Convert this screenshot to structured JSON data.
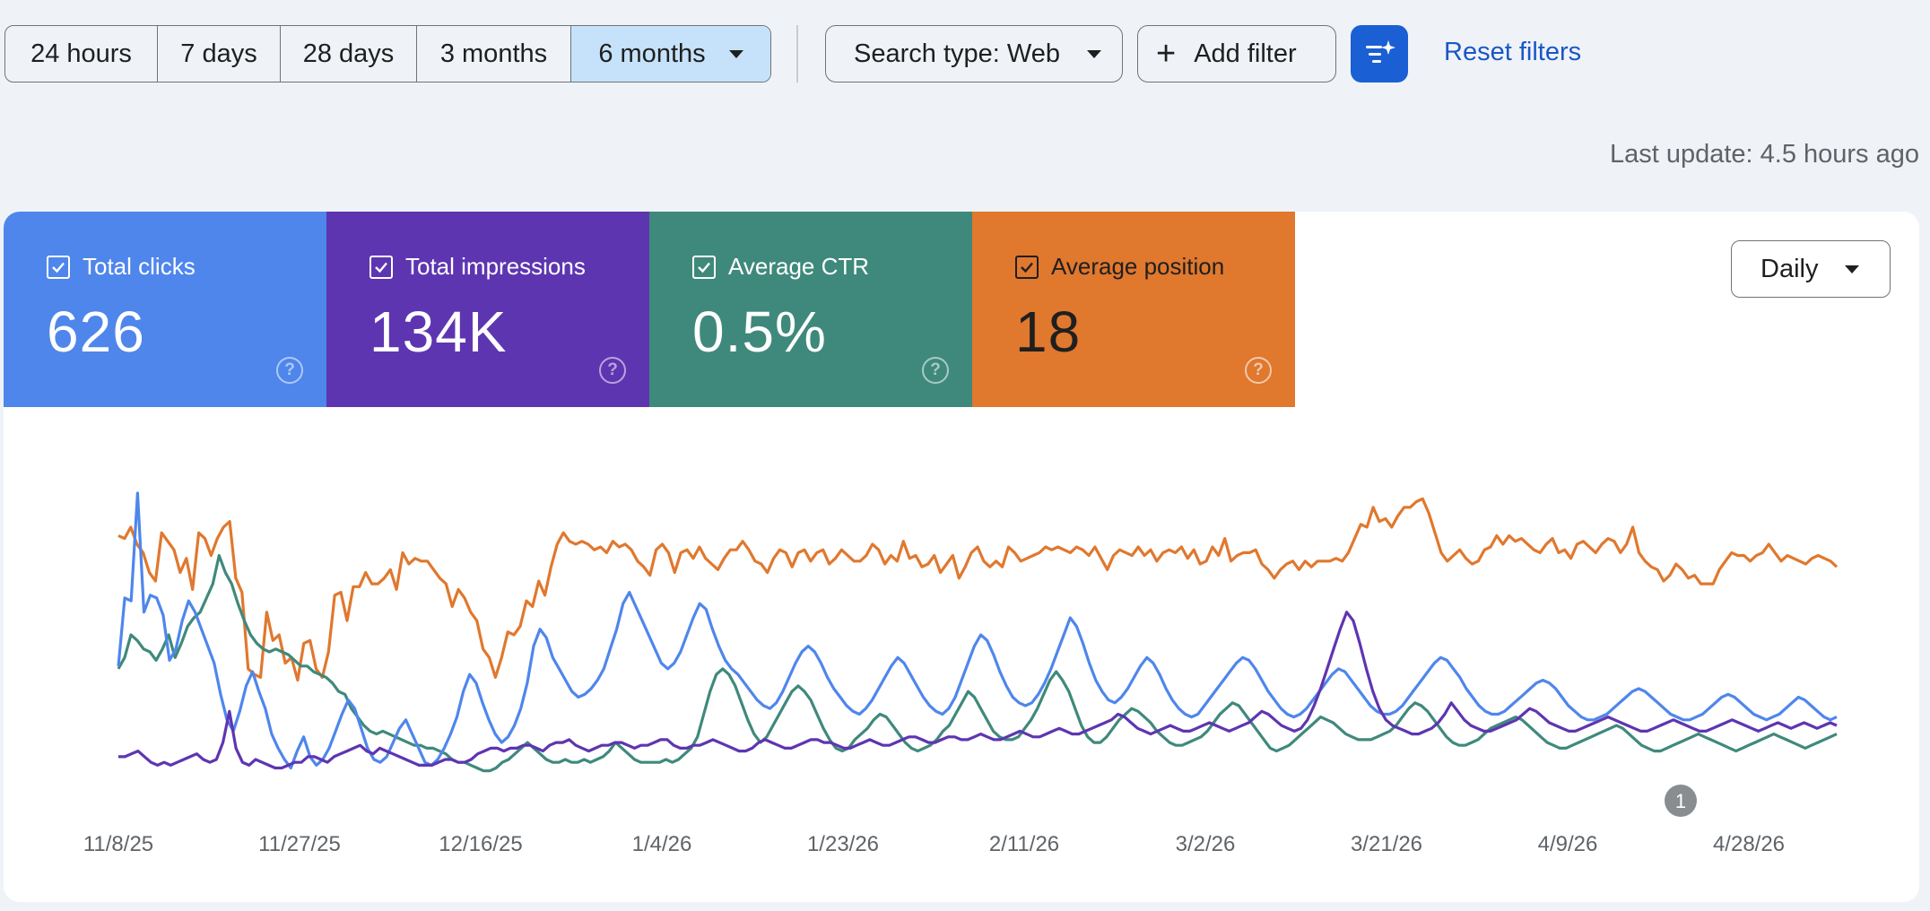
{
  "filters": {
    "ranges": [
      {
        "label": "24 hours",
        "width": 170
      },
      {
        "label": "7 days",
        "width": 137
      },
      {
        "label": "28 days",
        "width": 152
      },
      {
        "label": "3 months",
        "width": 172
      },
      {
        "label": "6 months",
        "width": 222,
        "selected": true
      }
    ],
    "search_type": "Search type: Web",
    "add_filter": "Add filter",
    "reset": "Reset filters"
  },
  "last_update": "Last update: 4.5 hours ago",
  "metrics": {
    "clicks": {
      "label": "Total clicks",
      "value": "626",
      "color": "#4f86ec"
    },
    "impressions": {
      "label": "Total impressions",
      "value": "134K",
      "color": "#5e35b1"
    },
    "ctr": {
      "label": "Average CTR",
      "value": "0.5%",
      "color": "#3f897c"
    },
    "position": {
      "label": "Average position",
      "value": "18",
      "color": "#e0782e"
    }
  },
  "granularity": "Daily",
  "chart_data": {
    "type": "line",
    "x_ticks": [
      "11/8/25",
      "11/27/25",
      "12/16/25",
      "1/4/26",
      "1/23/26",
      "2/11/26",
      "3/2/26",
      "3/21/26",
      "4/9/26",
      "4/28/26"
    ],
    "annotation": "1",
    "normalized": true,
    "series": [
      {
        "name": "Average position",
        "color": "#e0782e",
        "values": [
          0.85,
          0.84,
          0.88,
          0.82,
          0.79,
          0.72,
          0.69,
          0.86,
          0.83,
          0.8,
          0.72,
          0.77,
          0.66,
          0.86,
          0.84,
          0.78,
          0.84,
          0.88,
          0.9,
          0.7,
          0.65,
          0.38,
          0.36,
          0.35,
          0.58,
          0.48,
          0.5,
          0.4,
          0.42,
          0.34,
          0.47,
          0.48,
          0.38,
          0.35,
          0.44,
          0.64,
          0.65,
          0.55,
          0.67,
          0.67,
          0.72,
          0.68,
          0.68,
          0.7,
          0.73,
          0.66,
          0.79,
          0.75,
          0.77,
          0.76,
          0.76,
          0.73,
          0.7,
          0.68,
          0.6,
          0.66,
          0.63,
          0.58,
          0.55,
          0.45,
          0.42,
          0.35,
          0.42,
          0.51,
          0.5,
          0.53,
          0.62,
          0.6,
          0.69,
          0.64,
          0.74,
          0.82,
          0.86,
          0.83,
          0.82,
          0.83,
          0.82,
          0.8,
          0.81,
          0.79,
          0.83,
          0.81,
          0.82,
          0.8,
          0.76,
          0.74,
          0.71,
          0.8,
          0.82,
          0.79,
          0.72,
          0.79,
          0.8,
          0.77,
          0.81,
          0.77,
          0.75,
          0.73,
          0.77,
          0.8,
          0.8,
          0.83,
          0.8,
          0.76,
          0.75,
          0.72,
          0.77,
          0.8,
          0.79,
          0.74,
          0.79,
          0.8,
          0.76,
          0.79,
          0.8,
          0.75,
          0.77,
          0.8,
          0.78,
          0.76,
          0.76,
          0.78,
          0.82,
          0.8,
          0.75,
          0.78,
          0.76,
          0.83,
          0.77,
          0.78,
          0.74,
          0.75,
          0.78,
          0.72,
          0.75,
          0.78,
          0.7,
          0.74,
          0.79,
          0.81,
          0.76,
          0.74,
          0.76,
          0.74,
          0.81,
          0.79,
          0.76,
          0.77,
          0.78,
          0.79,
          0.81,
          0.8,
          0.81,
          0.8,
          0.79,
          0.81,
          0.8,
          0.78,
          0.81,
          0.77,
          0.73,
          0.78,
          0.8,
          0.79,
          0.78,
          0.81,
          0.78,
          0.8,
          0.76,
          0.79,
          0.8,
          0.79,
          0.81,
          0.77,
          0.8,
          0.75,
          0.76,
          0.81,
          0.78,
          0.84,
          0.76,
          0.78,
          0.79,
          0.79,
          0.8,
          0.75,
          0.73,
          0.7,
          0.73,
          0.75,
          0.76,
          0.73,
          0.76,
          0.74,
          0.76,
          0.76,
          0.76,
          0.77,
          0.76,
          0.79,
          0.84,
          0.89,
          0.88,
          0.95,
          0.9,
          0.91,
          0.88,
          0.92,
          0.95,
          0.95,
          0.97,
          0.98,
          0.93,
          0.86,
          0.79,
          0.76,
          0.78,
          0.8,
          0.77,
          0.75,
          0.76,
          0.8,
          0.81,
          0.85,
          0.82,
          0.85,
          0.83,
          0.84,
          0.82,
          0.8,
          0.79,
          0.82,
          0.84,
          0.79,
          0.8,
          0.77,
          0.82,
          0.83,
          0.81,
          0.79,
          0.82,
          0.84,
          0.83,
          0.79,
          0.82,
          0.88,
          0.79,
          0.76,
          0.74,
          0.73,
          0.69,
          0.71,
          0.75,
          0.73,
          0.7,
          0.71,
          0.68,
          0.68,
          0.68,
          0.73,
          0.76,
          0.79,
          0.78,
          0.78,
          0.76,
          0.78,
          0.79,
          0.82,
          0.79,
          0.76,
          0.78,
          0.77,
          0.76,
          0.75,
          0.77,
          0.78,
          0.77,
          0.76,
          0.74
        ]
      },
      {
        "name": "Average CTR",
        "color": "#3f897c",
        "values": [
          0.38,
          0.42,
          0.5,
          0.48,
          0.45,
          0.44,
          0.41,
          0.45,
          0.5,
          0.42,
          0.47,
          0.53,
          0.56,
          0.58,
          0.63,
          0.68,
          0.78,
          0.72,
          0.68,
          0.61,
          0.55,
          0.5,
          0.47,
          0.45,
          0.44,
          0.45,
          0.44,
          0.43,
          0.41,
          0.39,
          0.39,
          0.37,
          0.36,
          0.35,
          0.33,
          0.3,
          0.29,
          0.24,
          0.21,
          0.18,
          0.16,
          0.15,
          0.16,
          0.15,
          0.14,
          0.13,
          0.12,
          0.11,
          0.11,
          0.1,
          0.1,
          0.09,
          0.08,
          0.06,
          0.05,
          0.05,
          0.04,
          0.03,
          0.02,
          0.02,
          0.03,
          0.05,
          0.06,
          0.08,
          0.1,
          0.12,
          0.1,
          0.08,
          0.06,
          0.05,
          0.05,
          0.06,
          0.05,
          0.05,
          0.06,
          0.05,
          0.06,
          0.07,
          0.09,
          0.12,
          0.1,
          0.08,
          0.06,
          0.05,
          0.05,
          0.05,
          0.05,
          0.06,
          0.05,
          0.06,
          0.08,
          0.1,
          0.14,
          0.22,
          0.3,
          0.36,
          0.38,
          0.36,
          0.32,
          0.26,
          0.2,
          0.15,
          0.12,
          0.14,
          0.18,
          0.22,
          0.26,
          0.3,
          0.32,
          0.3,
          0.27,
          0.22,
          0.17,
          0.13,
          0.1,
          0.09,
          0.1,
          0.13,
          0.15,
          0.17,
          0.2,
          0.22,
          0.21,
          0.18,
          0.15,
          0.12,
          0.1,
          0.09,
          0.1,
          0.11,
          0.13,
          0.16,
          0.18,
          0.22,
          0.26,
          0.3,
          0.28,
          0.24,
          0.2,
          0.16,
          0.14,
          0.13,
          0.13,
          0.14,
          0.17,
          0.2,
          0.24,
          0.29,
          0.34,
          0.37,
          0.34,
          0.3,
          0.24,
          0.18,
          0.14,
          0.12,
          0.12,
          0.14,
          0.17,
          0.2,
          0.22,
          0.24,
          0.23,
          0.21,
          0.19,
          0.16,
          0.14,
          0.12,
          0.11,
          0.11,
          0.12,
          0.13,
          0.14,
          0.16,
          0.19,
          0.22,
          0.24,
          0.26,
          0.25,
          0.22,
          0.19,
          0.16,
          0.13,
          0.1,
          0.09,
          0.1,
          0.11,
          0.13,
          0.15,
          0.17,
          0.19,
          0.21,
          0.2,
          0.19,
          0.17,
          0.15,
          0.14,
          0.13,
          0.13,
          0.13,
          0.14,
          0.15,
          0.16,
          0.18,
          0.21,
          0.24,
          0.26,
          0.25,
          0.23,
          0.2,
          0.17,
          0.14,
          0.12,
          0.11,
          0.11,
          0.12,
          0.13,
          0.15,
          0.17,
          0.18,
          0.19,
          0.2,
          0.21,
          0.2,
          0.18,
          0.16,
          0.14,
          0.12,
          0.11,
          0.1,
          0.1,
          0.11,
          0.12,
          0.13,
          0.14,
          0.15,
          0.16,
          0.17,
          0.18,
          0.17,
          0.15,
          0.13,
          0.11,
          0.1,
          0.09,
          0.09,
          0.1,
          0.11,
          0.12,
          0.13,
          0.14,
          0.15,
          0.14,
          0.13,
          0.12,
          0.11,
          0.1,
          0.09,
          0.1,
          0.11,
          0.12,
          0.13,
          0.14,
          0.15,
          0.14,
          0.13,
          0.12,
          0.11,
          0.1,
          0.11,
          0.12,
          0.13,
          0.14,
          0.15
        ]
      },
      {
        "name": "Total clicks",
        "color": "#4f86ec",
        "values": [
          0.39,
          0.63,
          0.62,
          1.0,
          0.58,
          0.64,
          0.63,
          0.57,
          0.41,
          0.45,
          0.55,
          0.62,
          0.58,
          0.52,
          0.46,
          0.4,
          0.29,
          0.2,
          0.16,
          0.23,
          0.32,
          0.37,
          0.3,
          0.24,
          0.15,
          0.1,
          0.06,
          0.03,
          0.09,
          0.14,
          0.07,
          0.04,
          0.06,
          0.1,
          0.16,
          0.22,
          0.27,
          0.24,
          0.17,
          0.1,
          0.06,
          0.05,
          0.07,
          0.12,
          0.17,
          0.2,
          0.15,
          0.1,
          0.05,
          0.04,
          0.06,
          0.1,
          0.15,
          0.21,
          0.3,
          0.36,
          0.33,
          0.26,
          0.2,
          0.15,
          0.12,
          0.14,
          0.18,
          0.24,
          0.33,
          0.46,
          0.52,
          0.49,
          0.42,
          0.38,
          0.34,
          0.3,
          0.28,
          0.29,
          0.31,
          0.34,
          0.38,
          0.45,
          0.52,
          0.61,
          0.65,
          0.6,
          0.55,
          0.5,
          0.45,
          0.4,
          0.38,
          0.4,
          0.44,
          0.5,
          0.56,
          0.61,
          0.59,
          0.52,
          0.46,
          0.41,
          0.38,
          0.36,
          0.33,
          0.3,
          0.27,
          0.25,
          0.24,
          0.26,
          0.3,
          0.35,
          0.4,
          0.44,
          0.46,
          0.44,
          0.4,
          0.35,
          0.31,
          0.28,
          0.25,
          0.23,
          0.22,
          0.24,
          0.27,
          0.31,
          0.35,
          0.39,
          0.42,
          0.4,
          0.36,
          0.32,
          0.28,
          0.25,
          0.23,
          0.22,
          0.24,
          0.28,
          0.34,
          0.4,
          0.46,
          0.5,
          0.48,
          0.43,
          0.37,
          0.32,
          0.28,
          0.26,
          0.25,
          0.26,
          0.29,
          0.33,
          0.38,
          0.44,
          0.5,
          0.56,
          0.53,
          0.47,
          0.4,
          0.34,
          0.3,
          0.27,
          0.26,
          0.28,
          0.31,
          0.35,
          0.39,
          0.42,
          0.4,
          0.36,
          0.31,
          0.27,
          0.24,
          0.22,
          0.21,
          0.22,
          0.25,
          0.28,
          0.31,
          0.34,
          0.37,
          0.4,
          0.42,
          0.41,
          0.38,
          0.34,
          0.3,
          0.27,
          0.24,
          0.22,
          0.21,
          0.22,
          0.24,
          0.27,
          0.3,
          0.33,
          0.36,
          0.38,
          0.37,
          0.34,
          0.31,
          0.28,
          0.25,
          0.23,
          0.22,
          0.22,
          0.23,
          0.25,
          0.28,
          0.31,
          0.34,
          0.37,
          0.4,
          0.42,
          0.41,
          0.38,
          0.35,
          0.31,
          0.28,
          0.25,
          0.23,
          0.22,
          0.22,
          0.23,
          0.25,
          0.27,
          0.29,
          0.31,
          0.33,
          0.34,
          0.33,
          0.31,
          0.28,
          0.25,
          0.23,
          0.21,
          0.2,
          0.2,
          0.21,
          0.22,
          0.24,
          0.26,
          0.28,
          0.3,
          0.31,
          0.3,
          0.28,
          0.26,
          0.24,
          0.22,
          0.21,
          0.2,
          0.2,
          0.21,
          0.22,
          0.24,
          0.26,
          0.28,
          0.29,
          0.28,
          0.26,
          0.24,
          0.22,
          0.21,
          0.2,
          0.21,
          0.22,
          0.24,
          0.26,
          0.28,
          0.27,
          0.25,
          0.23,
          0.21,
          0.2,
          0.21
        ]
      },
      {
        "name": "Total impressions",
        "color": "#5e35b1",
        "values": [
          0.07,
          0.07,
          0.08,
          0.09,
          0.07,
          0.05,
          0.04,
          0.05,
          0.04,
          0.05,
          0.06,
          0.07,
          0.08,
          0.06,
          0.05,
          0.06,
          0.12,
          0.23,
          0.1,
          0.05,
          0.04,
          0.06,
          0.05,
          0.04,
          0.03,
          0.03,
          0.04,
          0.05,
          0.05,
          0.07,
          0.07,
          0.06,
          0.05,
          0.07,
          0.08,
          0.09,
          0.1,
          0.11,
          0.09,
          0.08,
          0.1,
          0.09,
          0.08,
          0.07,
          0.06,
          0.05,
          0.04,
          0.04,
          0.04,
          0.05,
          0.06,
          0.06,
          0.05,
          0.05,
          0.06,
          0.08,
          0.09,
          0.1,
          0.1,
          0.09,
          0.1,
          0.1,
          0.11,
          0.11,
          0.1,
          0.09,
          0.11,
          0.12,
          0.12,
          0.13,
          0.11,
          0.1,
          0.09,
          0.1,
          0.11,
          0.11,
          0.12,
          0.12,
          0.11,
          0.1,
          0.11,
          0.11,
          0.12,
          0.13,
          0.13,
          0.11,
          0.1,
          0.1,
          0.11,
          0.11,
          0.12,
          0.13,
          0.12,
          0.11,
          0.1,
          0.09,
          0.09,
          0.1,
          0.12,
          0.13,
          0.12,
          0.11,
          0.1,
          0.1,
          0.11,
          0.12,
          0.13,
          0.13,
          0.12,
          0.12,
          0.11,
          0.1,
          0.1,
          0.11,
          0.12,
          0.13,
          0.12,
          0.11,
          0.11,
          0.12,
          0.13,
          0.14,
          0.14,
          0.13,
          0.12,
          0.12,
          0.13,
          0.14,
          0.14,
          0.13,
          0.13,
          0.14,
          0.15,
          0.14,
          0.13,
          0.13,
          0.14,
          0.15,
          0.16,
          0.15,
          0.14,
          0.14,
          0.15,
          0.16,
          0.17,
          0.16,
          0.15,
          0.15,
          0.16,
          0.17,
          0.18,
          0.19,
          0.2,
          0.22,
          0.21,
          0.19,
          0.17,
          0.16,
          0.15,
          0.16,
          0.17,
          0.18,
          0.17,
          0.16,
          0.16,
          0.17,
          0.18,
          0.19,
          0.18,
          0.17,
          0.16,
          0.17,
          0.18,
          0.19,
          0.21,
          0.23,
          0.22,
          0.2,
          0.18,
          0.17,
          0.16,
          0.17,
          0.2,
          0.25,
          0.31,
          0.38,
          0.45,
          0.52,
          0.58,
          0.55,
          0.47,
          0.38,
          0.3,
          0.24,
          0.2,
          0.18,
          0.17,
          0.16,
          0.15,
          0.15,
          0.16,
          0.17,
          0.19,
          0.22,
          0.26,
          0.23,
          0.2,
          0.18,
          0.17,
          0.16,
          0.16,
          0.17,
          0.18,
          0.19,
          0.2,
          0.22,
          0.24,
          0.23,
          0.21,
          0.19,
          0.18,
          0.17,
          0.16,
          0.16,
          0.17,
          0.18,
          0.19,
          0.2,
          0.21,
          0.2,
          0.19,
          0.18,
          0.17,
          0.16,
          0.16,
          0.17,
          0.18,
          0.19,
          0.2,
          0.19,
          0.18,
          0.17,
          0.16,
          0.16,
          0.17,
          0.18,
          0.19,
          0.2,
          0.19,
          0.18,
          0.17,
          0.16,
          0.17,
          0.18,
          0.19,
          0.18,
          0.17,
          0.18,
          0.19,
          0.18,
          0.17,
          0.18,
          0.19,
          0.18
        ]
      }
    ]
  }
}
